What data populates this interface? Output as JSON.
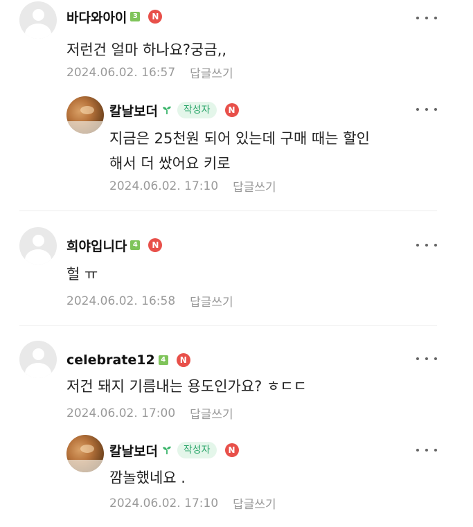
{
  "colors": {
    "level_badge": "#7fc45a",
    "n_badge": "#e8504a",
    "author_badge_bg": "#e4f6ea",
    "author_badge_text": "#2aa56a",
    "sprout": "#3bb56b",
    "divider": "#ececec"
  },
  "comments": [
    {
      "nickname": "바다와아이",
      "level": "3",
      "n_badge": "N",
      "text": "저런건 얼마 하나요?궁금,,",
      "date": "2024.06.02. 16:57",
      "reply_label": "답글쓰기",
      "replies": [
        {
          "nickname": "칼날보더",
          "author_badge": "작성자",
          "n_badge": "N",
          "text_line1": "지금은 25천원 되어 있는데 구매 때는 할인",
          "text_line2": "해서 더 쌌어요 키로",
          "date": "2024.06.02. 17:10",
          "reply_label": "답글쓰기"
        }
      ]
    },
    {
      "nickname": "희야입니다",
      "level": "4",
      "n_badge": "N",
      "text": "헐 ㅠ",
      "date": "2024.06.02. 16:58",
      "reply_label": "답글쓰기"
    },
    {
      "nickname": "celebrate12",
      "level": "4",
      "n_badge": "N",
      "text": "저건 돼지 기름내는 용도인가요? ㅎㄷㄷ",
      "date": "2024.06.02. 17:00",
      "reply_label": "답글쓰기",
      "replies": [
        {
          "nickname": "칼날보더",
          "author_badge": "작성자",
          "n_badge": "N",
          "text": "깜놀했네요 .",
          "date": "2024.06.02. 17:10",
          "reply_label": "답글쓰기"
        }
      ]
    }
  ]
}
